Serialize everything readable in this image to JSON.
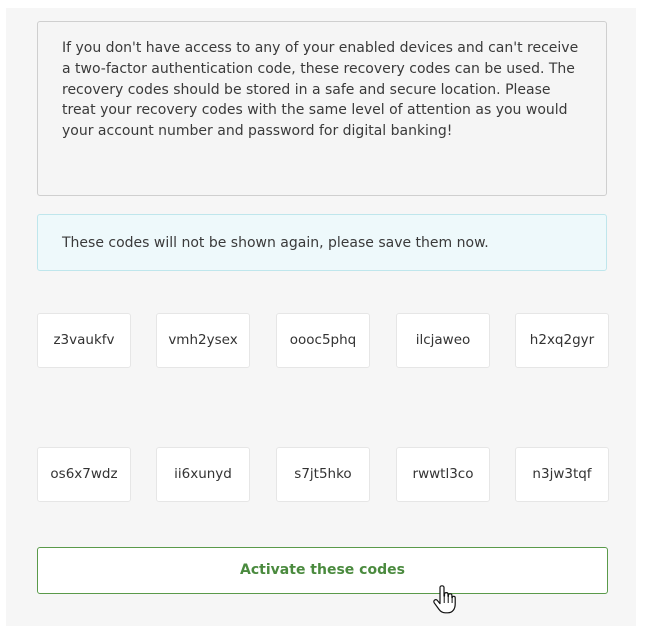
{
  "info": {
    "text": "If you don't have access to any of your enabled devices and can't receive a two-factor authentication code, these recovery codes can be used. The recovery codes should be stored in a safe and secure location. Please treat your recovery codes with the same level of attention as you would your account number and password for digital banking!"
  },
  "alert": {
    "text": "These codes will not be shown again, please save them now."
  },
  "codes": {
    "row1": [
      "z3vaukfv",
      "vmh2ysex",
      "oooc5phq",
      "ilcjaweo",
      "h2xq2gyr"
    ],
    "row2": [
      "os6x7wdz",
      "ii6xunyd",
      "s7jt5hko",
      "rwwtl3co",
      "n3jw3tqf"
    ]
  },
  "actions": {
    "activate_label": "Activate these codes"
  },
  "colors": {
    "accent_green": "#4a8a3e",
    "alert_bg": "#eef9fb",
    "alert_border": "#bfe6ec"
  },
  "icons": {
    "cursor": "hand-pointer-icon"
  }
}
